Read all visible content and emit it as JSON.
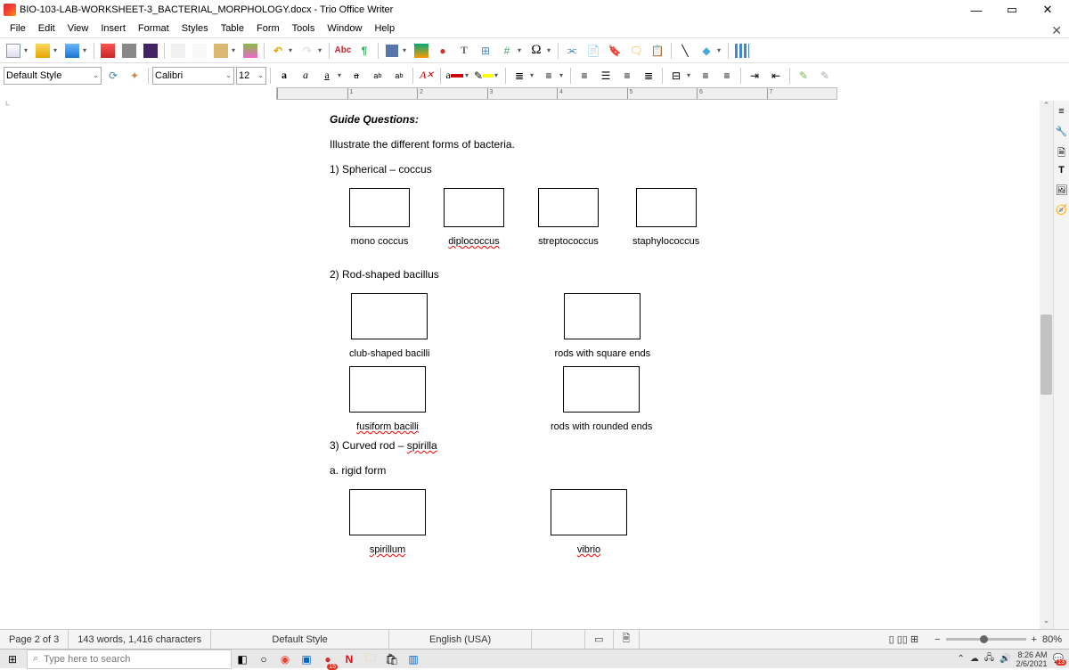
{
  "titlebar": {
    "title": "BIO-103-LAB-WORKSHEET-3_BACTERIAL_MORPHOLOGY.docx - Trio Office Writer"
  },
  "menu": {
    "file": "File",
    "edit": "Edit",
    "view": "View",
    "insert": "Insert",
    "format": "Format",
    "styles": "Styles",
    "table": "Table",
    "form": "Form",
    "tools": "Tools",
    "window": "Window",
    "help": "Help"
  },
  "toolbar2": {
    "paragraph_style": "Default Style",
    "font_name": "Calibri",
    "font_size": "12"
  },
  "spellcheck_label": "Abc",
  "ruler": {
    "marks": [
      "1",
      "2",
      "3",
      "4",
      "5",
      "6",
      "7"
    ]
  },
  "doc": {
    "guide_questions": "Guide Questions:",
    "intro": "Illustrate the different forms of bacteria.",
    "s1_title": "1) Spherical – coccus",
    "s1": {
      "a": "mono coccus",
      "b": "diplococcus",
      "c": "streptococcus",
      "d": "staphylococcus"
    },
    "s2_title": "2) Rod-shaped bacillus",
    "s2": {
      "a": "club-shaped bacilli",
      "b": "rods with square ends",
      "c": "fusiform bacilli",
      "d": "rods with rounded ends"
    },
    "s3_title": "3) Curved rod – spirilla",
    "s3_sub": "a. rigid form",
    "s3": {
      "a": "spirillum",
      "b": "vibrio"
    }
  },
  "status": {
    "page": "Page 2 of 3",
    "words": "143 words, 1,416 characters",
    "style": "Default Style",
    "lang": "English (USA)",
    "zoom": "80%"
  },
  "taskbar": {
    "search_placeholder": "Type here to search",
    "time": "8:26 AM",
    "date": "2/6/2021",
    "notif_count": "13",
    "tray_badge": "15"
  }
}
